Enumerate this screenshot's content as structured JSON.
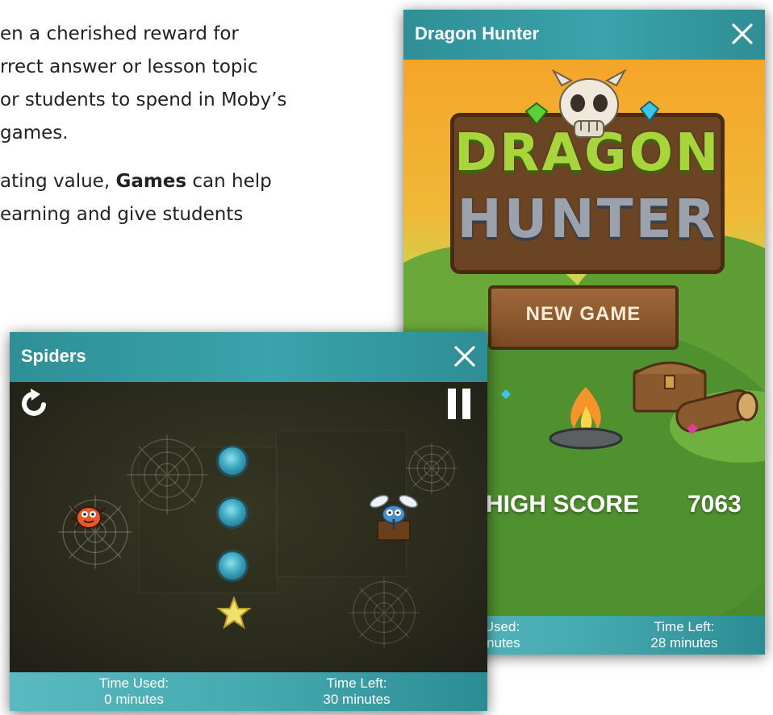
{
  "article": {
    "para1_lines": [
      "en a cherished reward for",
      "rrect answer or lesson topic",
      "or students to spend in Moby’s",
      "games."
    ],
    "para2_line1_pre": "ating value, ",
    "para2_bold": "Games",
    "para2_line1_post": " can help",
    "para2_line2": "earning and give students"
  },
  "dragon_window": {
    "title": "Dragon Hunter",
    "logo_top": "DRAGON",
    "logo_bottom": "HUNTER",
    "new_game_label": "NEW GAME",
    "high_score_label": "HIGH SCORE",
    "high_score_value": "7063",
    "time_used_label": "Used:",
    "time_used_value": "inutes",
    "time_left_label": "Time Left:",
    "time_left_value": "28 minutes"
  },
  "spiders_window": {
    "title": "Spiders",
    "time_used_label": "Time Used:",
    "time_used_value": "0 minutes",
    "time_left_label": "Time Left:",
    "time_left_value": "30 minutes"
  },
  "colors": {
    "titlebar": "#3aa3ab",
    "footer": "#46aab1",
    "spiders_board": "#2c2c1e",
    "stone": "#3aa6bd"
  },
  "icons": {
    "close": "close-icon",
    "restart": "restart-icon",
    "pause": "pause-icon"
  }
}
